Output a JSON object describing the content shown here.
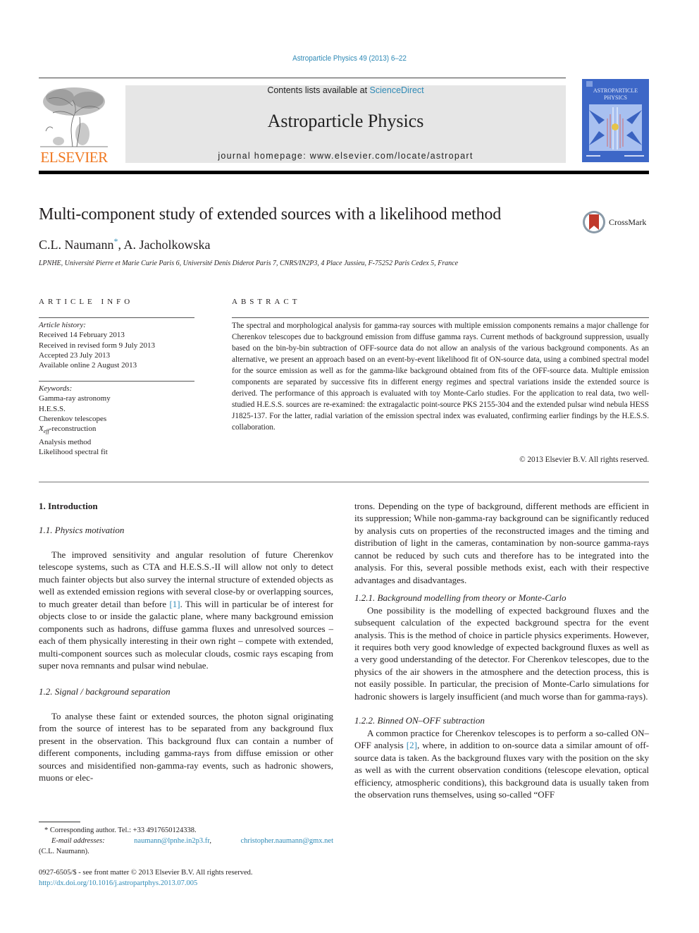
{
  "header": {
    "citation": "Astroparticle Physics 49 (2013) 6–22",
    "contents_prefix": "Contents lists available at ",
    "contents_link": "ScienceDirect",
    "journal_name": "Astroparticle Physics",
    "homepage": "journal homepage: www.elsevier.com/locate/astropart",
    "publisher_logo_text": "ELSEVIER",
    "cover_title_line1": "ASTROPARTICLE",
    "cover_title_line2": "PHYSICS",
    "crossmark_label": "CrossMark"
  },
  "article": {
    "title": "Multi-component study of extended sources with a likelihood method",
    "authors": [
      {
        "name": "C.L. Naumann",
        "mark": "*"
      },
      {
        "name": "A. Jacholkowska",
        "mark": ""
      }
    ],
    "author_separator": ", ",
    "affiliation": "LPNHE, Université Pierre et Marie Curie Paris 6, Université Denis Diderot Paris 7, CNRS/IN2P3, 4 Place Jussieu, F-75252 Paris Cedex 5, France"
  },
  "article_info": {
    "heading": "ARTICLE INFO",
    "history_label": "Article history:",
    "history": [
      "Received 14 February 2013",
      "Received in revised form 9 July 2013",
      "Accepted 23 July 2013",
      "Available online 2 August 2013"
    ],
    "keywords_label": "Keywords:",
    "keywords": [
      "Gamma-ray astronomy",
      "H.E.S.S.",
      "Cherenkov telescopes",
      "X_eff-reconstruction",
      "Analysis method",
      "Likelihood spectral fit"
    ],
    "keyword_xeff_base": "X",
    "keyword_xeff_sub": "eff",
    "keyword_xeff_suffix": "-reconstruction"
  },
  "abstract": {
    "heading": "ABSTRACT",
    "text": "The spectral and morphological analysis for gamma-ray sources with multiple emission components remains a major challenge for Cherenkov telescopes due to background emission from diffuse gamma rays. Current methods of background suppression, usually based on the bin-by-bin subtraction of OFF-source data do not allow an analysis of the various background components. As an alternative, we present an approach based on an event-by-event likelihood fit of ON-source data, using a combined spectral model for the source emission as well as for the gamma-like background obtained from fits of the OFF-source data. Multiple emission components are separated by successive fits in different energy regimes and spectral variations inside the extended source is derived. The performance of this approach is evaluated with toy Monte-Carlo studies. For the application to real data, two well-studied H.E.S.S. sources are re-examined: the extragalactic point-source PKS 2155-304 and the extended pulsar wind nebula HESS J1825-137. For the latter, radial variation of the emission spectral index was evaluated, confirming earlier findings by the H.E.S.S. collaboration.",
    "copyright": "© 2013 Elsevier B.V. All rights reserved."
  },
  "body": {
    "section1_heading": "1. Introduction",
    "section1_1_heading": "1.1. Physics motivation",
    "para1_a": "The improved sensitivity and angular resolution of future Cherenkov telescope systems, such as CTA and H.E.S.S.-II will allow not only to detect much fainter objects but also survey the internal structure of extended objects as well as extended emission regions with several close-by or overlapping sources, to much greater detail than before ",
    "para1_ref": "[1]",
    "para1_b": ". This will in particular be of interest for objects close to or inside the galactic plane, where many background emission components such as hadrons, diffuse gamma fluxes and unresolved sources – each of them physically interesting in their own right – compete with extended, multi-component sources such as molecular clouds, cosmic rays escaping from super nova remnants and pulsar wind nebulae.",
    "section1_2_heading": "1.2. Signal / background separation",
    "para2": "To analyse these faint or extended sources, the photon signal originating from the source of interest has to be separated from any background flux present in the observation. This background flux can contain a number of different components, including gamma-rays from diffuse emission or other sources and misidentified non-gamma-ray events, such as hadronic showers, muons or electrons. Depending on the type of background, different methods are efficient in its suppression; While non-gamma-ray background can be significantly reduced by analysis cuts on properties of the reconstructed images and the timing and distribution of light in the cameras, contamination by non-source gamma-rays cannot be reduced by such cuts and therefore has to be integrated into the analysis. For this, several possible methods exist, each with their respective advantages and disadvantages.",
    "para2_left": "To analyse these faint or extended sources, the photon signal originating from the source of interest has to be separated from any background flux present in the observation. This background flux can contain a number of different components, including gamma-rays from diffuse emission or other sources and misidentified non-gamma-ray events, such as hadronic showers, muons or elec-",
    "para2_right": "trons. Depending on the type of background, different methods are efficient in its suppression; While non-gamma-ray background can be significantly reduced by analysis cuts on properties of the reconstructed images and the timing and distribution of light in the cameras, contamination by non-source gamma-rays cannot be reduced by such cuts and therefore has to be integrated into the analysis. For this, several possible methods exist, each with their respective advantages and disadvantages.",
    "section1_2_1_heading": "1.2.1. Background modelling from theory or Monte-Carlo",
    "para3": "One possibility is the modelling of expected background fluxes and the subsequent calculation of the expected background spectra for the event analysis. This is the method of choice in particle physics experiments. However, it requires both very good knowledge of expected background fluxes as well as a very good understanding of the detector. For Cherenkov telescopes, due to the physics of the air showers in the atmosphere and the detection process, this is not easily possible. In particular, the precision of Monte-Carlo simulations for hadronic showers is largely insufficient (and much worse than for gamma-rays).",
    "section1_2_2_heading": "1.2.2. Binned ON–OFF subtraction",
    "para4_a": "A common practice for Cherenkov telescopes is to perform a so-called ON–OFF analysis ",
    "para4_ref": "[2]",
    "para4_b": ", where, in addition to on-source data a similar amount of off-source data is taken. As the background fluxes vary with the position on the sky as well as with the current observation conditions (telescope elevation, optical efficiency, atmospheric conditions), this background data is usually taken from the observation runs themselves, using so-called “OFF"
  },
  "footnotes": {
    "corresponding": "* Corresponding author. Tel.: +33 4917650124338.",
    "email_label": "E-mail addresses:",
    "email1": "naumann@lpnhe.in2p3.fr",
    "email_sep": ",",
    "email2": "christopher.naumann@gmx.net",
    "email_owner": "(C.L. Naumann).",
    "front_matter": "0927-6505/$ - see front matter © 2013 Elsevier B.V. All rights reserved.",
    "doi": "http://dx.doi.org/10.1016/j.astropartphys.2013.07.005"
  },
  "colors": {
    "link": "#2f8ab6",
    "elsevier_orange": "#f07820",
    "banner_gray": "#e6e6e6",
    "cover_blue": "#3d67c7",
    "crossmark_red": "#c0392b"
  }
}
